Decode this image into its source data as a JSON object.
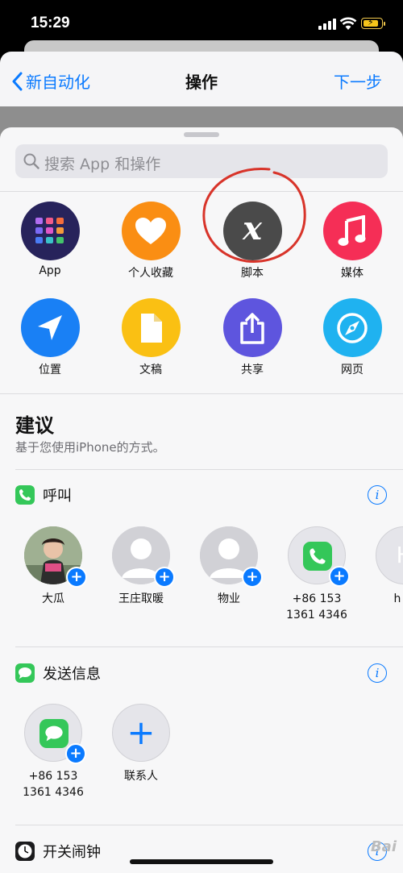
{
  "status": {
    "time": "15:29"
  },
  "nav": {
    "back_label": "新自动化",
    "title": "操作",
    "next_label": "下一步"
  },
  "search": {
    "placeholder": "搜索 App 和操作"
  },
  "categories": [
    {
      "label": "App",
      "icon": "app-grid-icon",
      "color": "#27235b"
    },
    {
      "label": "个人收藏",
      "icon": "heart-icon",
      "color": "#fa8e13"
    },
    {
      "label": "脚本",
      "icon": "script-x-icon",
      "color": "#4a4a4a"
    },
    {
      "label": "媒体",
      "icon": "music-note-icon",
      "color": "#f52e56"
    },
    {
      "label": "位置",
      "icon": "location-arrow-icon",
      "color": "#1980f5"
    },
    {
      "label": "文稿",
      "icon": "document-icon",
      "color": "#fac013"
    },
    {
      "label": "共享",
      "icon": "share-icon",
      "color": "#5e55de"
    },
    {
      "label": "网页",
      "icon": "compass-icon",
      "color": "#1fb2f0"
    }
  ],
  "suggestions": {
    "title": "建议",
    "subtitle": "基于您使用iPhone的方式。"
  },
  "call_group": {
    "title": "呼叫",
    "contacts": [
      {
        "name": "大瓜"
      },
      {
        "name": "王庄取暖"
      },
      {
        "name": "物业"
      },
      {
        "name": "+86 153\n1361 4346"
      },
      {
        "name": "h m",
        "initial": "H"
      }
    ]
  },
  "message_group": {
    "title": "发送信息",
    "contacts": [
      {
        "name": "+86 153\n1361 4346"
      },
      {
        "name": "联系人"
      }
    ]
  },
  "alarm_group": {
    "title": "开关闹钟"
  },
  "watermark": "Bai"
}
